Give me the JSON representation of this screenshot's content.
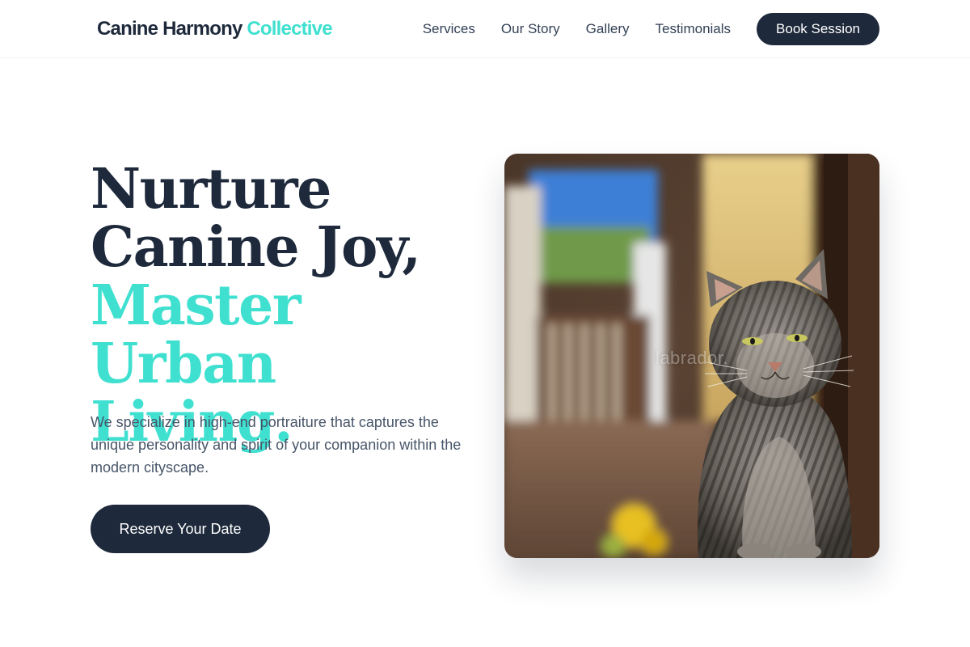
{
  "header": {
    "brand_primary": "Canine Harmony",
    "brand_accent": "Collective",
    "nav": [
      "Services",
      "Our Story",
      "Gallery",
      "Testimonials"
    ],
    "cta": "Book Session"
  },
  "hero": {
    "title_line1": "Nurture",
    "title_line2": "Canine Joy,",
    "title_line3": "Master Urban",
    "title_line4": "Living.",
    "subtitle": "We specialize in high-end portraiture that captures the unique personality and spirit of your companion within the modern cityscape.",
    "cta": "Reserve Your Date"
  },
  "image": {
    "caption": "labrador.",
    "subject": "tabby cat on porch"
  },
  "colors": {
    "primary": "#1e293b",
    "accent": "#40e0d0",
    "muted_text": "#475569"
  }
}
